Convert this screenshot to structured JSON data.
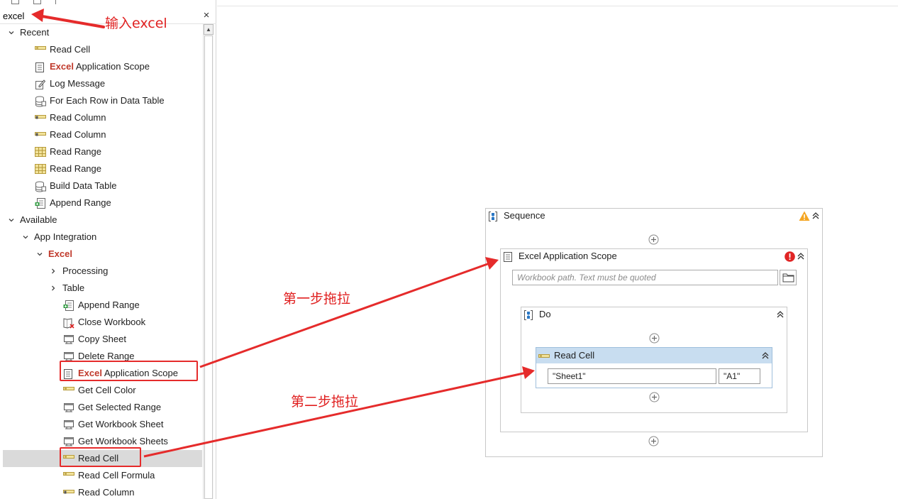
{
  "search": {
    "value": "excel",
    "clear_label": "×"
  },
  "tree": {
    "recent_label": "Recent",
    "recent": [
      {
        "label": "Read Cell",
        "icon": "read-cell-icon"
      },
      {
        "prefix": "Excel",
        "label": " Application Scope",
        "icon": "excel-scope-icon"
      },
      {
        "label": "Log Message",
        "icon": "log-message-icon"
      },
      {
        "label": "For Each Row in Data Table",
        "icon": "data-table-icon"
      },
      {
        "label": "Read Column",
        "icon": "read-column-icon"
      },
      {
        "label": "Read Column",
        "icon": "read-column-icon"
      },
      {
        "label": "Read Range",
        "icon": "read-range-icon"
      },
      {
        "label": "Read Range",
        "icon": "read-range-icon"
      },
      {
        "label": "Build Data Table",
        "icon": "data-table-icon"
      },
      {
        "label": "Append Range",
        "icon": "append-range-icon"
      }
    ],
    "available_label": "Available",
    "app_integration_label": "App Integration",
    "excel_label": "Excel",
    "processing_label": "Processing",
    "table_label": "Table",
    "excel_items": [
      {
        "label": "Append Range",
        "icon": "append-range-icon"
      },
      {
        "label": "Close Workbook",
        "icon": "close-workbook-icon"
      },
      {
        "label": "Copy Sheet",
        "icon": "sheet-icon"
      },
      {
        "label": "Delete Range",
        "icon": "sheet-icon"
      },
      {
        "prefix": "Excel",
        "label": " Application Scope",
        "icon": "excel-scope-icon"
      },
      {
        "label": "Get Cell Color",
        "icon": "read-cell-icon"
      },
      {
        "label": "Get Selected Range",
        "icon": "sheet-icon"
      },
      {
        "label": "Get Workbook Sheet",
        "icon": "sheet-icon"
      },
      {
        "label": "Get Workbook Sheets",
        "icon": "sheet-icon"
      },
      {
        "label": "Read Cell",
        "icon": "read-cell-icon"
      },
      {
        "label": "Read Cell Formula",
        "icon": "read-cell-icon"
      },
      {
        "label": "Read Column",
        "icon": "read-column-icon"
      }
    ]
  },
  "designer": {
    "sequence_title": "Sequence",
    "scope_title": "Excel Application Scope",
    "workbook_placeholder": "Workbook path. Text must be quoted",
    "do_title": "Do",
    "read_cell_title": "Read Cell",
    "sheet_value": "\"Sheet1\"",
    "cell_value": "\"A1\""
  },
  "annotations": {
    "type_excel": "输入excel",
    "step1": "第一步拖拉",
    "step2": "第二步拖拉"
  },
  "colors": {
    "annotation": "#e02020",
    "highlight": "#e52b2b",
    "excel_text": "#c0392b",
    "read_cell_header": "#c8ddf0",
    "selected_row": "#dadada"
  }
}
